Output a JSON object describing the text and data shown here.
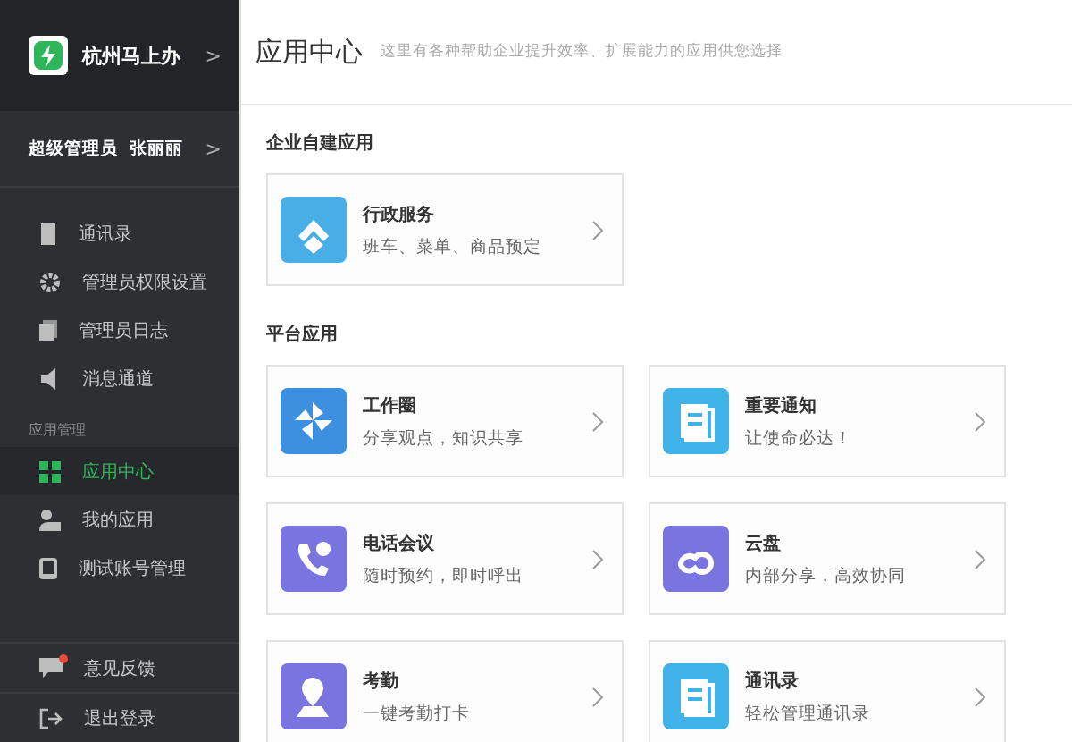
{
  "sidebar": {
    "org": {
      "name": "杭州马上办",
      "chevron": ">"
    },
    "admin": {
      "label": "超级管理员  张丽丽",
      "chevron": ">"
    },
    "items": [
      {
        "label": "通讯录",
        "kind": "book",
        "selected": false
      },
      {
        "label": "管理员权限设置",
        "kind": "gear",
        "selected": false
      },
      {
        "label": "管理员日志",
        "kind": "doc",
        "selected": false
      },
      {
        "label": "消息通道",
        "kind": "speaker",
        "selected": false
      }
    ],
    "section": "应用管理",
    "app_items": [
      {
        "label": "应用中心",
        "kind": "grid",
        "selected": true
      },
      {
        "label": "我的应用",
        "kind": "person",
        "selected": false
      },
      {
        "label": "测试账号管理",
        "kind": "phone",
        "selected": false
      }
    ],
    "footer": [
      {
        "label": "意见反馈",
        "kind": "chat",
        "badge": true
      },
      {
        "label": "退出登录",
        "kind": "exit",
        "badge": false
      }
    ]
  },
  "header": {
    "title": "应用中心",
    "subtitle": "这里有各种帮助企业提升效率、扩展能力的应用供您选择"
  },
  "sections": [
    {
      "title": "企业自建应用",
      "apps": [
        {
          "name": "行政服务",
          "desc": "班车、菜单、商品预定",
          "kind": "house",
          "color": "#4aaee6"
        }
      ]
    },
    {
      "title": "平台应用",
      "apps": [
        {
          "name": "工作圈",
          "desc": "分享观点，知识共享",
          "kind": "pinwheel",
          "color": "#3d8fe0"
        },
        {
          "name": "重要通知",
          "desc": "让使命必达！",
          "kind": "notice",
          "color": "#3fb3e8"
        },
        {
          "name": "电话会议",
          "desc": "随时预约，即时呼出",
          "kind": "call",
          "color": "#7a74e0"
        },
        {
          "name": "云盘",
          "desc": "内部分享，高效协同",
          "kind": "cloud",
          "color": "#7a74e0"
        },
        {
          "name": "考勤",
          "desc": "一键考勤打卡",
          "kind": "pin",
          "color": "#7a74e0"
        },
        {
          "name": "通讯录",
          "desc": "轻松管理通讯录",
          "kind": "notice",
          "color": "#3fb3e8"
        }
      ]
    }
  ]
}
